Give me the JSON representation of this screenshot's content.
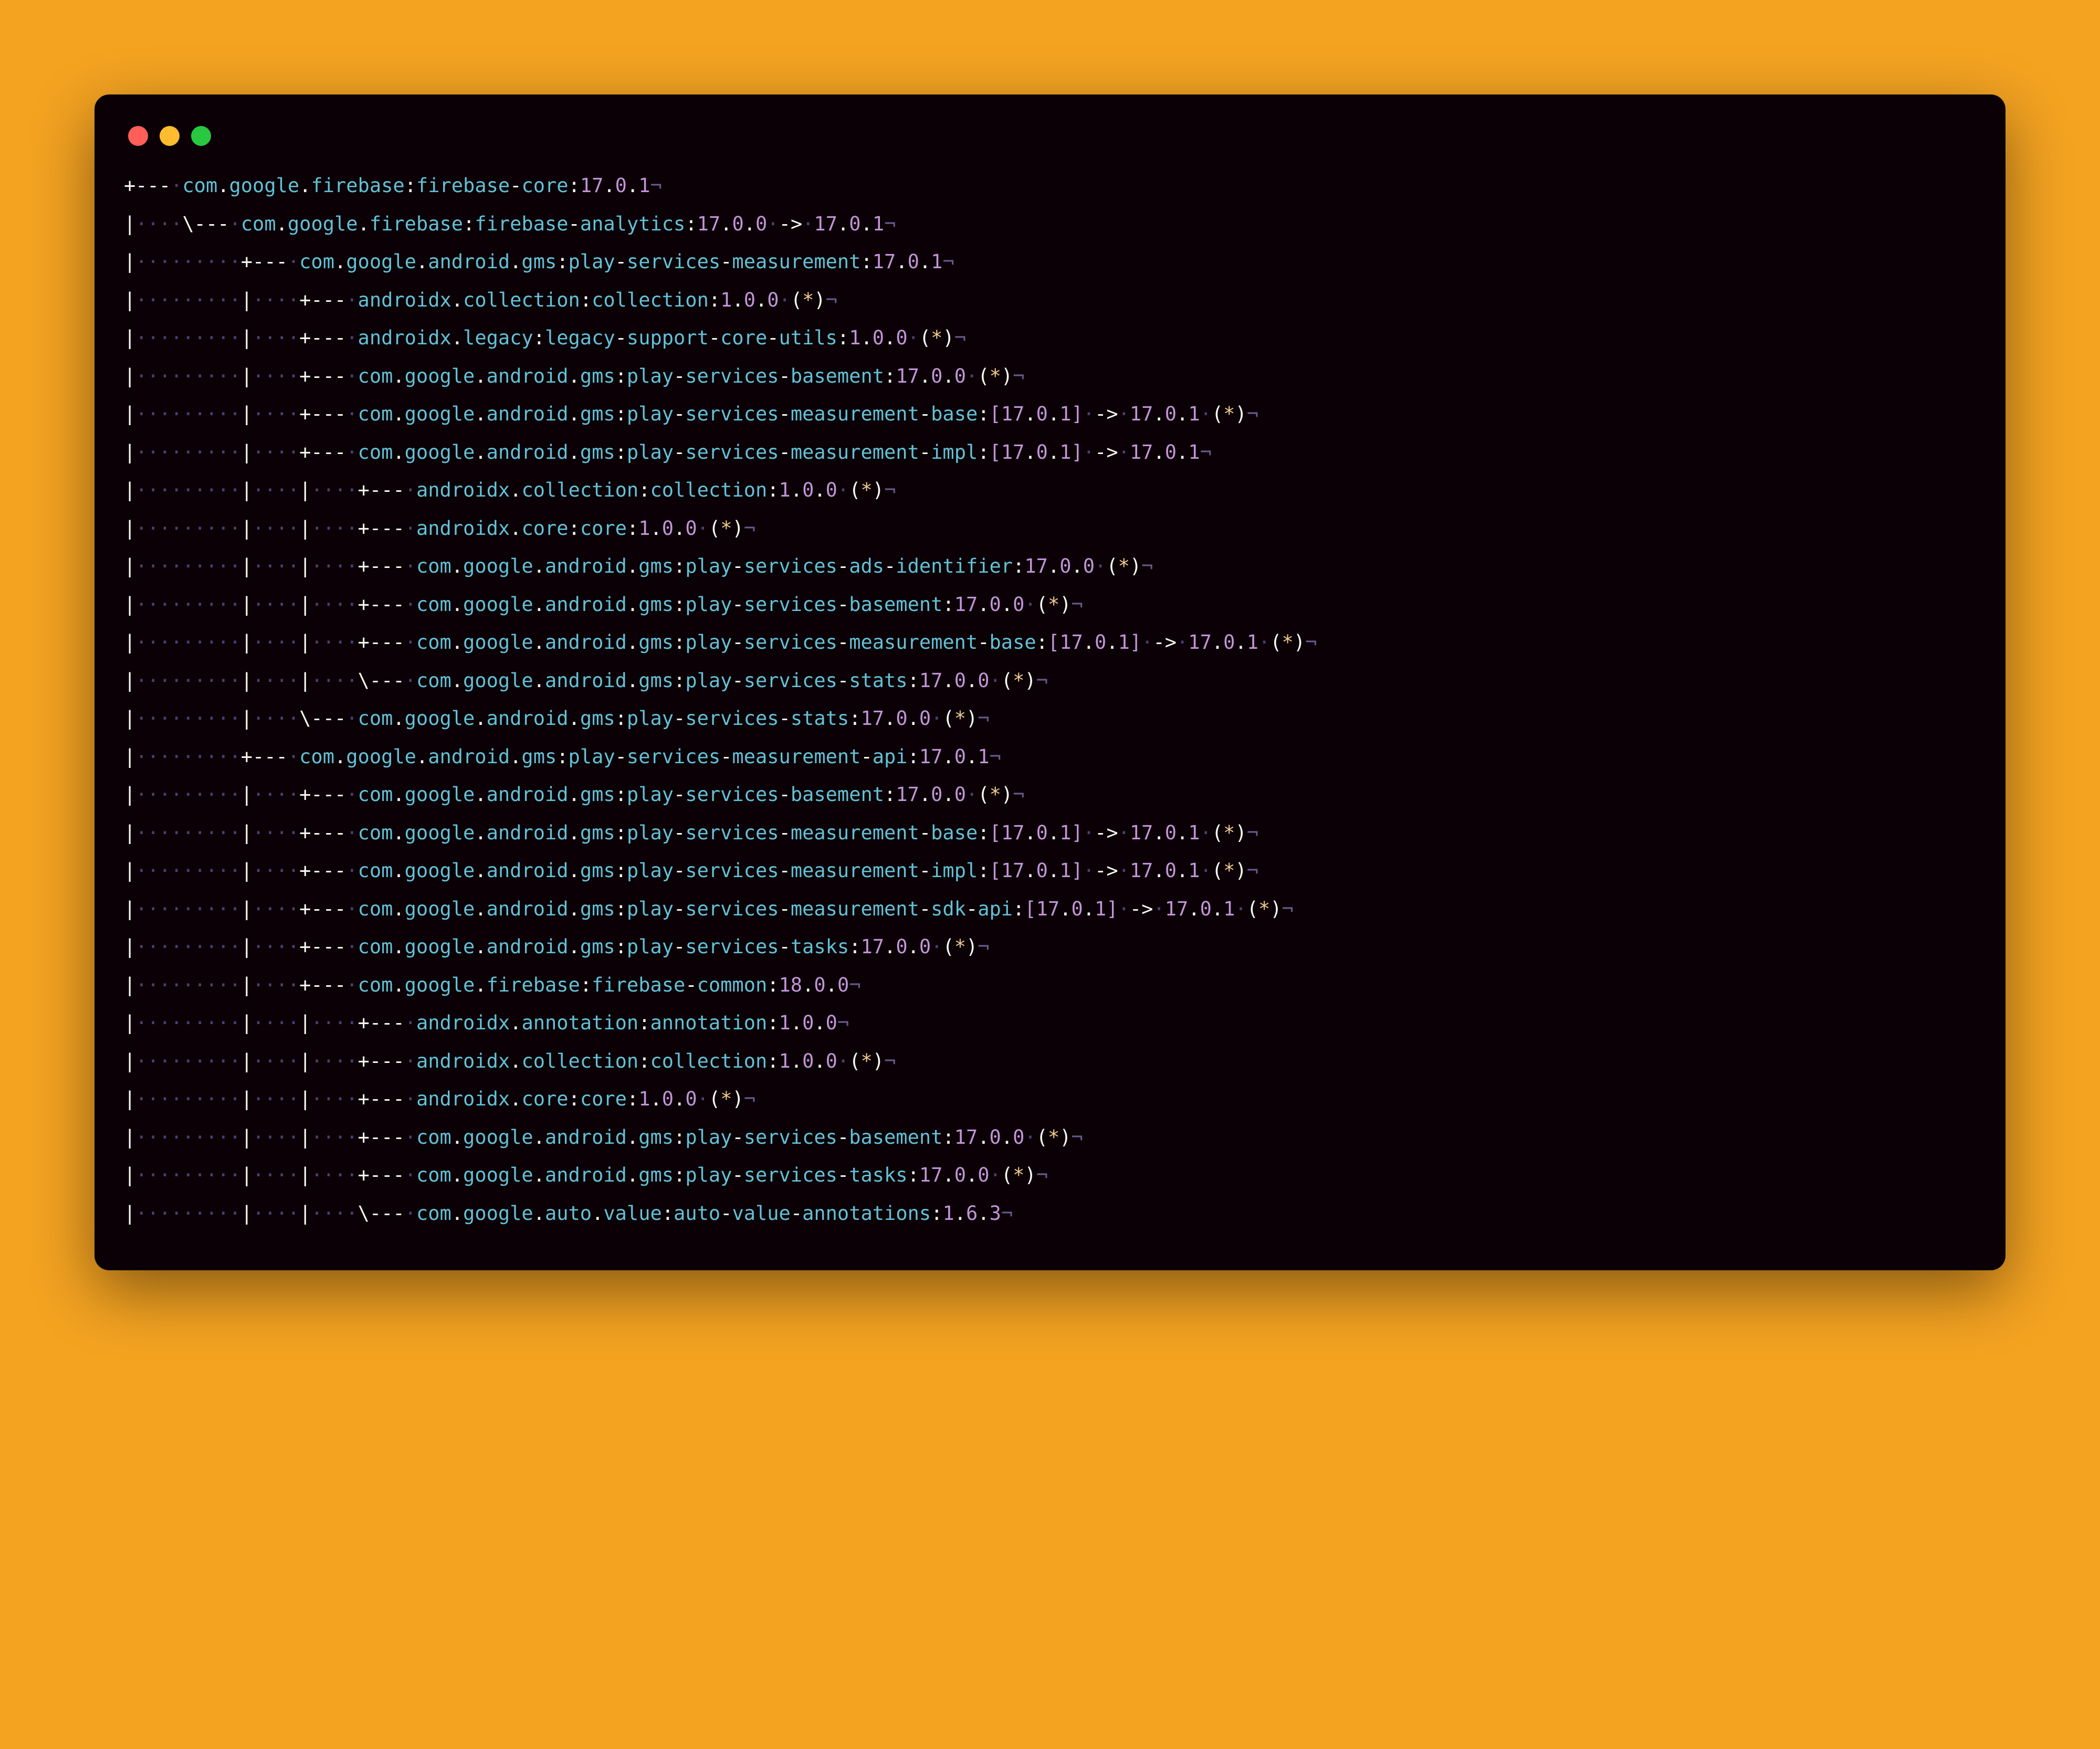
{
  "whitespace_glyph": "·",
  "eol_glyph": "¬",
  "arrow_glyph": "->",
  "lines": [
    {
      "tree": "+---",
      "pad": 1,
      "group": "com.google.firebase",
      "artifact": "firebase-core",
      "version": "17.0.1"
    },
    {
      "tree": "|    \\---",
      "pad": 1,
      "group": "com.google.firebase",
      "artifact": "firebase-analytics",
      "version": "17.0.0",
      "resolved": "17.0.1"
    },
    {
      "tree": "|         +---",
      "pad": 1,
      "group": "com.google.android.gms",
      "artifact": "play-services-measurement",
      "version": "17.0.1"
    },
    {
      "tree": "|         |    +---",
      "pad": 1,
      "group": "androidx.collection",
      "artifact": "collection",
      "version": "1.0.0",
      "star": true
    },
    {
      "tree": "|         |    +---",
      "pad": 1,
      "group": "androidx.legacy",
      "artifact": "legacy-support-core-utils",
      "version": "1.0.0",
      "star": true
    },
    {
      "tree": "|         |    +---",
      "pad": 1,
      "group": "com.google.android.gms",
      "artifact": "play-services-basement",
      "version": "17.0.0",
      "star": true
    },
    {
      "tree": "|         |    +---",
      "pad": 1,
      "group": "com.google.android.gms",
      "artifact": "play-services-measurement-base",
      "bracket_version": "17.0.1",
      "resolved": "17.0.1",
      "star": true
    },
    {
      "tree": "|         |    +---",
      "pad": 1,
      "group": "com.google.android.gms",
      "artifact": "play-services-measurement-impl",
      "bracket_version": "17.0.1",
      "resolved": "17.0.1"
    },
    {
      "tree": "|         |    |    +---",
      "pad": 1,
      "group": "androidx.collection",
      "artifact": "collection",
      "version": "1.0.0",
      "star": true
    },
    {
      "tree": "|         |    |    +---",
      "pad": 1,
      "group": "androidx.core",
      "artifact": "core",
      "version": "1.0.0",
      "star": true
    },
    {
      "tree": "|         |    |    +---",
      "pad": 1,
      "group": "com.google.android.gms",
      "artifact": "play-services-ads-identifier",
      "version": "17.0.0",
      "star": true
    },
    {
      "tree": "|         |    |    +---",
      "pad": 1,
      "group": "com.google.android.gms",
      "artifact": "play-services-basement",
      "version": "17.0.0",
      "star": true
    },
    {
      "tree": "|         |    |    +---",
      "pad": 1,
      "group": "com.google.android.gms",
      "artifact": "play-services-measurement-base",
      "bracket_version": "17.0.1",
      "resolved": "17.0.1",
      "star": true
    },
    {
      "tree": "|         |    |    \\---",
      "pad": 1,
      "group": "com.google.android.gms",
      "artifact": "play-services-stats",
      "version": "17.0.0",
      "star": true
    },
    {
      "tree": "|         |    \\---",
      "pad": 1,
      "group": "com.google.android.gms",
      "artifact": "play-services-stats",
      "version": "17.0.0",
      "star": true
    },
    {
      "tree": "|         +---",
      "pad": 1,
      "group": "com.google.android.gms",
      "artifact": "play-services-measurement-api",
      "version": "17.0.1"
    },
    {
      "tree": "|         |    +---",
      "pad": 1,
      "group": "com.google.android.gms",
      "artifact": "play-services-basement",
      "version": "17.0.0",
      "star": true
    },
    {
      "tree": "|         |    +---",
      "pad": 1,
      "group": "com.google.android.gms",
      "artifact": "play-services-measurement-base",
      "bracket_version": "17.0.1",
      "resolved": "17.0.1",
      "star": true
    },
    {
      "tree": "|         |    +---",
      "pad": 1,
      "group": "com.google.android.gms",
      "artifact": "play-services-measurement-impl",
      "bracket_version": "17.0.1",
      "resolved": "17.0.1",
      "star": true
    },
    {
      "tree": "|         |    +---",
      "pad": 1,
      "group": "com.google.android.gms",
      "artifact": "play-services-measurement-sdk-api",
      "bracket_version": "17.0.1",
      "resolved": "17.0.1",
      "star": true
    },
    {
      "tree": "|         |    +---",
      "pad": 1,
      "group": "com.google.android.gms",
      "artifact": "play-services-tasks",
      "version": "17.0.0",
      "star": true
    },
    {
      "tree": "|         |    +---",
      "pad": 1,
      "group": "com.google.firebase",
      "artifact": "firebase-common",
      "version": "18.0.0"
    },
    {
      "tree": "|         |    |    +---",
      "pad": 1,
      "group": "androidx.annotation",
      "artifact": "annotation",
      "version": "1.0.0"
    },
    {
      "tree": "|         |    |    +---",
      "pad": 1,
      "group": "androidx.collection",
      "artifact": "collection",
      "version": "1.0.0",
      "star": true
    },
    {
      "tree": "|         |    |    +---",
      "pad": 1,
      "group": "androidx.core",
      "artifact": "core",
      "version": "1.0.0",
      "star": true
    },
    {
      "tree": "|         |    |    +---",
      "pad": 1,
      "group": "com.google.android.gms",
      "artifact": "play-services-basement",
      "version": "17.0.0",
      "star": true
    },
    {
      "tree": "|         |    |    +---",
      "pad": 1,
      "group": "com.google.android.gms",
      "artifact": "play-services-tasks",
      "version": "17.0.0",
      "star": true
    },
    {
      "tree": "|         |    |    \\---",
      "pad": 1,
      "group": "com.google.auto.value",
      "artifact": "auto-value-annotations",
      "version": "1.6.3"
    }
  ]
}
